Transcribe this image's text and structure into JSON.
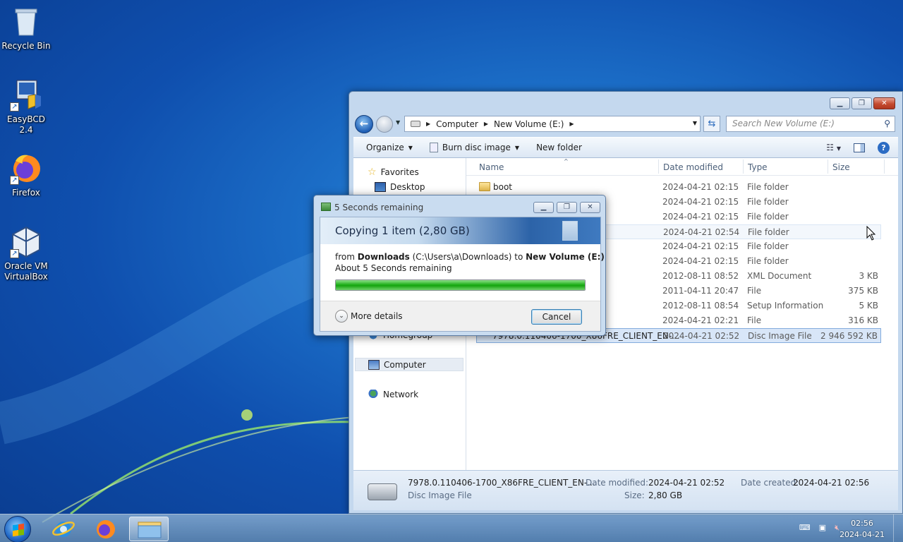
{
  "desktop": {
    "icons": [
      {
        "label": "Recycle Bin"
      },
      {
        "label": "EasyBCD 2.4"
      },
      {
        "label": "Firefox"
      },
      {
        "label": "Oracle VM VirtualBox"
      }
    ]
  },
  "explorer": {
    "address": {
      "crumbs": [
        "Computer",
        "New Volume (E:)"
      ]
    },
    "search_placeholder": "Search New Volume (E:)",
    "toolbar": {
      "organize": "Organize",
      "burn": "Burn disc image",
      "new_folder": "New folder"
    },
    "nav": {
      "favorites": "Favorites",
      "desktop": "Desktop",
      "homegroup": "Homegroup",
      "computer": "Computer",
      "network": "Network"
    },
    "columns": {
      "name": "Name",
      "date": "Date modified",
      "type": "Type",
      "size": "Size"
    },
    "rows": [
      {
        "name": "boot",
        "date": "2024-04-21 02:15",
        "type": "File folder",
        "size": ""
      },
      {
        "name": "",
        "date": "2024-04-21 02:15",
        "type": "File folder",
        "size": ""
      },
      {
        "name": "",
        "date": "2024-04-21 02:15",
        "type": "File folder",
        "size": ""
      },
      {
        "name": "",
        "date": "2024-04-21 02:54",
        "type": "File folder",
        "size": ""
      },
      {
        "name": "",
        "date": "2024-04-21 02:15",
        "type": "File folder",
        "size": ""
      },
      {
        "name": "",
        "date": "2024-04-21 02:15",
        "type": "File folder",
        "size": ""
      },
      {
        "name": "",
        "date": "2012-08-11 08:52",
        "type": "XML Document",
        "size": "3 KB"
      },
      {
        "name": "",
        "date": "2011-04-11 20:47",
        "type": "File",
        "size": "375 KB"
      },
      {
        "name": "",
        "date": "2012-08-11 08:54",
        "type": "Setup Information",
        "size": "5 KB"
      },
      {
        "name": "",
        "date": "2024-04-21 02:21",
        "type": "File",
        "size": "316 KB"
      },
      {
        "name": "7978.0.110406-1700_X86FRE_CLIENT_EN-...",
        "date": "2024-04-21 02:52",
        "type": "Disc Image File",
        "size": "2 946 592 KB"
      }
    ],
    "details": {
      "filename": "7978.0.110406-1700_X86FRE_CLIENT_EN-...",
      "filetype": "Disc Image File",
      "date_modified_label": "Date modified:",
      "date_modified": "2024-04-21 02:52",
      "size_label": "Size:",
      "size": "2,80 GB",
      "date_created_label": "Date created:",
      "date_created": "2024-04-21 02:56"
    }
  },
  "copy_dialog": {
    "title": "5 Seconds remaining",
    "heading": "Copying 1 item (2,80 GB)",
    "from_word": "from",
    "source": "Downloads",
    "source_path": "(C:\\Users\\a\\Downloads)",
    "to_word": "to",
    "destination": "New Volume (E:)",
    "remaining": "About 5 Seconds remaining",
    "progress_percent": 100,
    "more_details": "More details",
    "cancel": "Cancel"
  },
  "taskbar": {
    "time": "02:56",
    "date": "2024-04-21"
  }
}
